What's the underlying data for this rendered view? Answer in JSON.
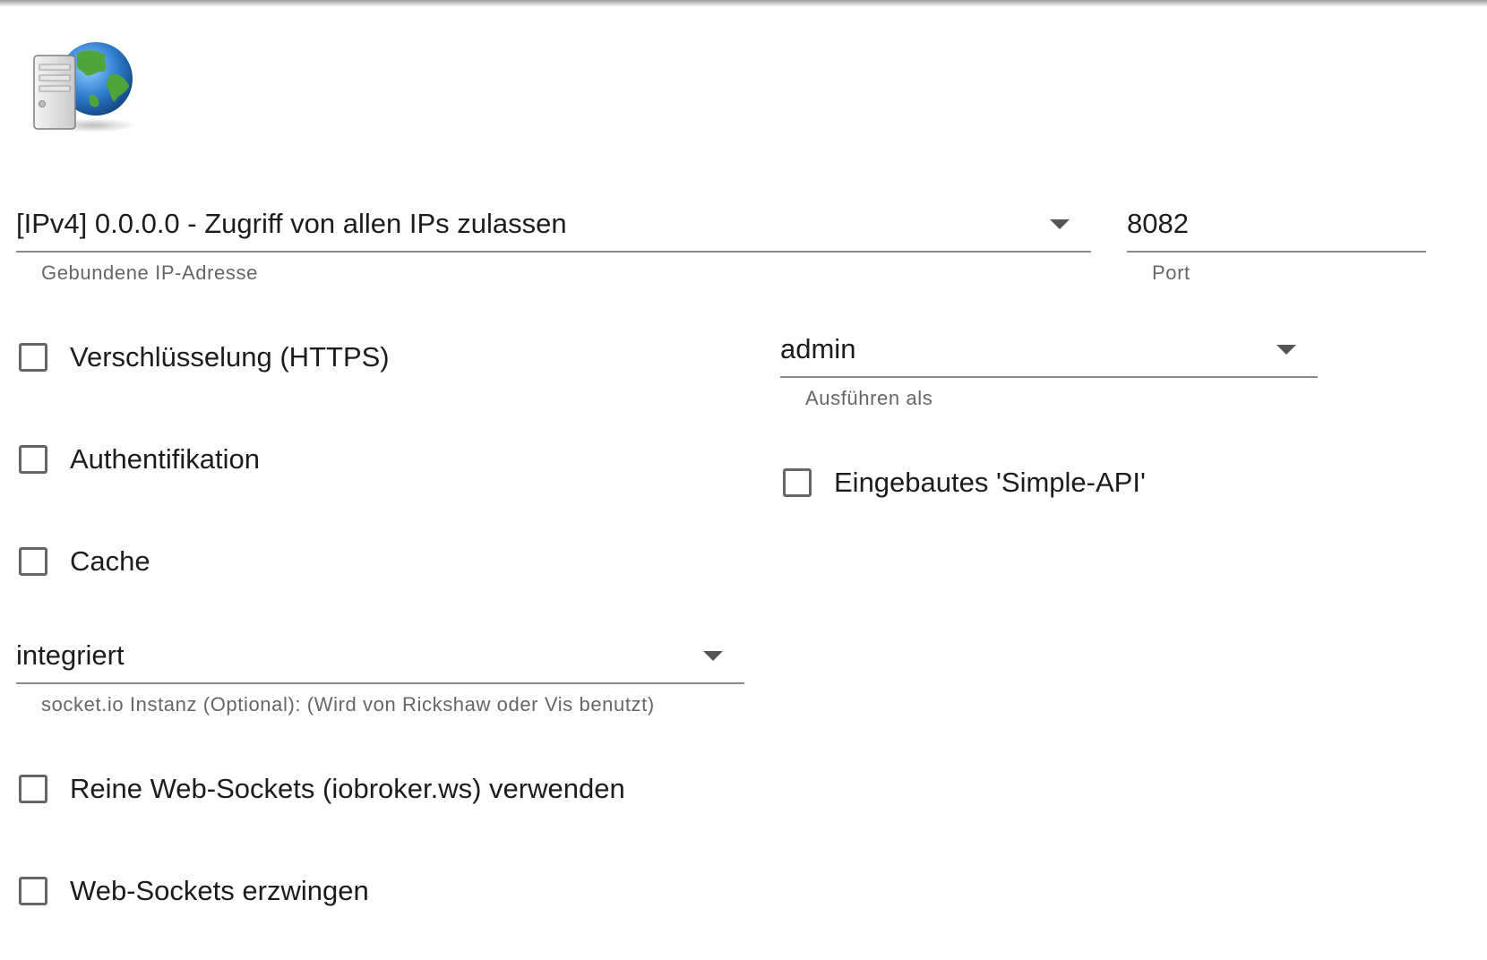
{
  "bind_ip": {
    "value": "[IPv4] 0.0.0.0 - Zugriff von allen IPs zulassen",
    "helper": "Gebundene IP-Adresse"
  },
  "port": {
    "value": "8082",
    "helper": "Port"
  },
  "run_as": {
    "value": "admin",
    "helper": "Ausführen als"
  },
  "socketio": {
    "value": "integriert",
    "helper": "socket.io Instanz (Optional): (Wird von Rickshaw oder Vis benutzt)"
  },
  "checkboxes": {
    "https": {
      "label": "Verschlüsselung (HTTPS)",
      "checked": false
    },
    "auth": {
      "label": "Authentifikation",
      "checked": false
    },
    "cache": {
      "label": "Cache",
      "checked": false
    },
    "simple_api": {
      "label": "Eingebautes 'Simple-API'",
      "checked": false
    },
    "pure_ws": {
      "label": "Reine Web-Sockets (iobroker.ws) verwenden",
      "checked": false
    },
    "force_ws": {
      "label": "Web-Sockets erzwingen",
      "checked": false
    }
  },
  "icons": {
    "logo": "server-globe-icon",
    "dropdown": "chevron-down-icon"
  },
  "colors": {
    "underline": "#8a8a8a",
    "helper_text": "#666666",
    "text": "#1c1c1c"
  }
}
